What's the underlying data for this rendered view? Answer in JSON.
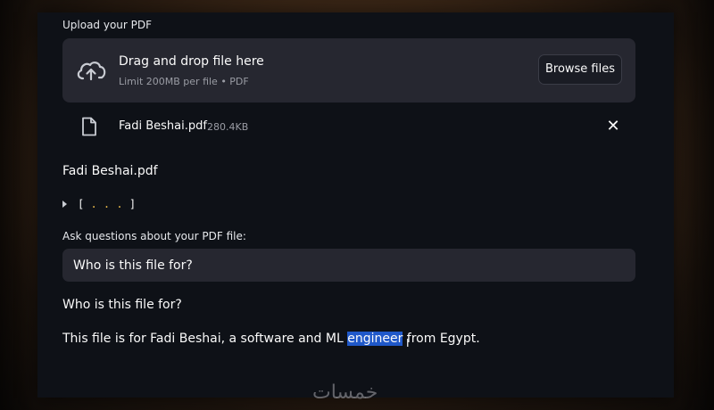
{
  "upload": {
    "label": "Upload your PDF",
    "dropzone_title": "Drag and drop file here",
    "dropzone_subtitle": "Limit 200MB per file • PDF",
    "browse_label": "Browse files"
  },
  "uploaded_file": {
    "name": "Fadi Beshai.pdf",
    "size": "280.4KB"
  },
  "content": {
    "filename_heading": "Fadi Beshai.pdf",
    "expander_open": "[",
    "expander_dots": " . . . ",
    "expander_close": "]",
    "ask_label": "Ask questions about your PDF file:",
    "question_value": "Who is this file for?",
    "echo_question": "Who is this file for?",
    "answer_before": "This file is for Fadi Beshai, a software and ML ",
    "answer_highlight": "engineer",
    "answer_after": " from Egypt."
  },
  "watermark": "خمسات",
  "colors": {
    "panel_bg": "#0e1117",
    "widget_bg": "#262730",
    "highlight": "#1f58c9",
    "code_accent": "#e9b949"
  },
  "icons": {
    "upload": "cloud-upload-icon",
    "file": "file-icon",
    "remove": "close-icon",
    "expander": "caret-right-icon",
    "cursor": "text-cursor-icon"
  }
}
